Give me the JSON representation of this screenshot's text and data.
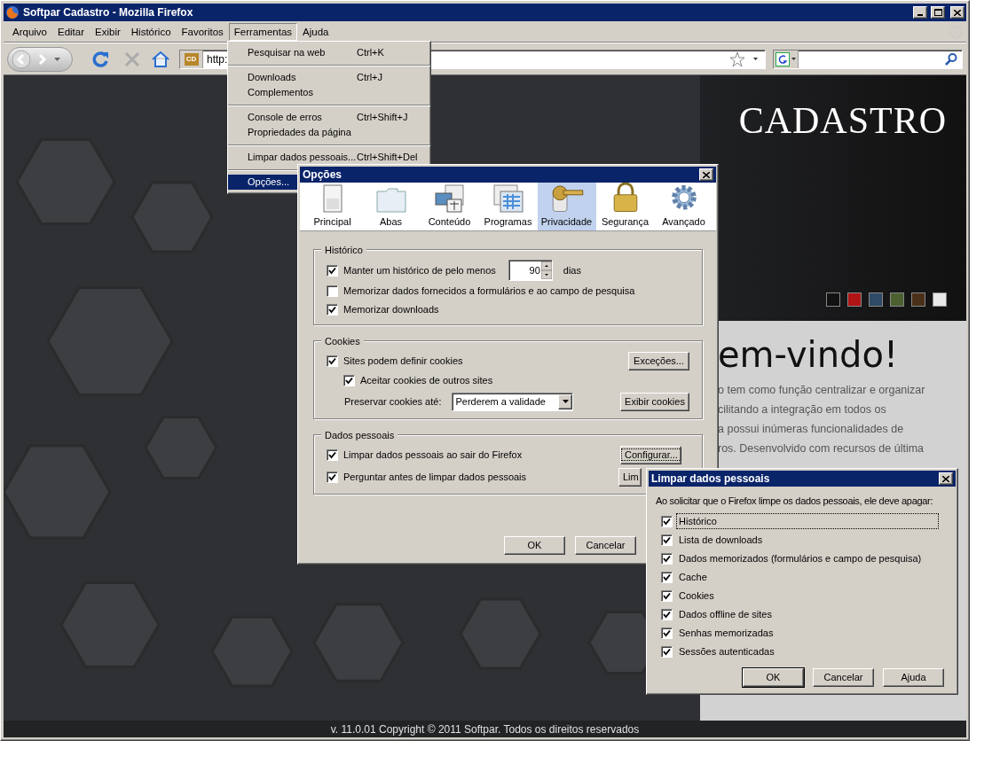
{
  "window": {
    "title": "Softpar Cadastro - Mozilla Firefox"
  },
  "menu_bar": [
    {
      "label": "Arquivo",
      "selected": false
    },
    {
      "label": "Editar",
      "selected": false
    },
    {
      "label": "Exibir",
      "selected": false
    },
    {
      "label": "Histórico",
      "selected": false
    },
    {
      "label": "Favoritos",
      "selected": false
    },
    {
      "label": "Ferramentas",
      "selected": true
    },
    {
      "label": "Ajuda",
      "selected": false
    }
  ],
  "toolbar": {
    "site_icon_text": "CD",
    "url": "http:"
  },
  "tools_menu": {
    "groups": [
      [
        {
          "label": "Pesquisar na web",
          "shortcut": "Ctrl+K",
          "selected": false
        }
      ],
      [
        {
          "label": "Downloads",
          "shortcut": "Ctrl+J",
          "selected": false
        },
        {
          "label": "Complementos",
          "selected": false
        }
      ],
      [
        {
          "label": "Console de erros",
          "shortcut": "Ctrl+Shift+J",
          "selected": false
        },
        {
          "label": "Propriedades da página",
          "selected": false
        }
      ],
      [
        {
          "label": "Limpar dados pessoais...",
          "shortcut": "Ctrl+Shift+Del",
          "selected": false
        }
      ],
      [
        {
          "label": "Opções...",
          "selected": true
        }
      ]
    ]
  },
  "page": {
    "brand": "CADASTRO",
    "themes": [
      {
        "color": "#111111"
      },
      {
        "color": "#b01414"
      },
      {
        "color": "#2e4a66"
      },
      {
        "color": "#4c6030"
      },
      {
        "color": "#4a3018"
      },
      {
        "color": "#e8e8e8"
      }
    ],
    "heading": "em-vindo!",
    "lines": [
      "o tem como função centralizar e organizar",
      "cilitando a integração em todos os",
      "a possui inúmeras funcionalidades de",
      "ros. Desenvolvido com recursos de última"
    ],
    "footer": "v. 11.0.01 Copyright © 2011 Softpar. Todos os direitos reservados"
  },
  "options_dialog": {
    "title": "Opções",
    "tabs": [
      {
        "label": "Principal",
        "selected": false
      },
      {
        "label": "Abas",
        "selected": false
      },
      {
        "label": "Conteúdo",
        "selected": false
      },
      {
        "label": "Programas",
        "selected": false
      },
      {
        "label": "Privacidade",
        "selected": true
      },
      {
        "label": "Segurança",
        "selected": false
      },
      {
        "label": "Avançado",
        "selected": false
      }
    ],
    "history": {
      "title": "Histórico",
      "keep_label": "Manter um histórico de pelo menos",
      "keep_checked": true,
      "days": "90",
      "days_unit": "dias",
      "items": [
        {
          "label": "Memorizar dados fornecidos a formulários e ao campo de pesquisa",
          "checked": false
        },
        {
          "label": "Memorizar downloads",
          "checked": true
        }
      ]
    },
    "cookies": {
      "title": "Cookies",
      "accept_label": "Sites podem definir cookies",
      "accept_checked": true,
      "exceptions_button": "Exceções...",
      "third_party_label": "Aceitar cookies de outros sites",
      "third_party_checked": true,
      "keep_label": "Preservar cookies até:",
      "keep_value": "Perderem a validade",
      "show_button": "Exibir cookies"
    },
    "personal": {
      "title": "Dados pessoais",
      "items": [
        {
          "label": "Limpar dados pessoais ao sair do Firefox",
          "checked": true,
          "button": "Configurar...",
          "focused": true
        },
        {
          "label": "Perguntar antes de limpar dados pessoais",
          "checked": true,
          "button": "Lim",
          "focused": false
        }
      ]
    },
    "buttons": [
      "OK",
      "Cancelar"
    ]
  },
  "clear_dialog": {
    "title": "Limpar dados pessoais",
    "intro": "Ao solicitar que o Firefox limpe os dados pessoais, ele deve apagar:",
    "items": [
      {
        "label": "Histórico",
        "checked": true,
        "focused": true
      },
      {
        "label": "Lista de downloads",
        "checked": true,
        "focused": false
      },
      {
        "label": "Dados memorizados (formulários e campo de pesquisa)",
        "checked": true,
        "focused": false
      },
      {
        "label": "Cache",
        "checked": true,
        "focused": false
      },
      {
        "label": "Cookies",
        "checked": true,
        "focused": false
      },
      {
        "label": "Dados offline de sites",
        "checked": true,
        "focused": false
      },
      {
        "label": "Senhas memorizadas",
        "checked": true,
        "focused": false
      },
      {
        "label": "Sessões autenticadas",
        "checked": true,
        "focused": false
      }
    ],
    "buttons": [
      {
        "label": "OK",
        "default": true
      },
      {
        "label": "Cancelar",
        "default": false
      },
      {
        "label": "Ajuda",
        "default": false
      }
    ]
  }
}
